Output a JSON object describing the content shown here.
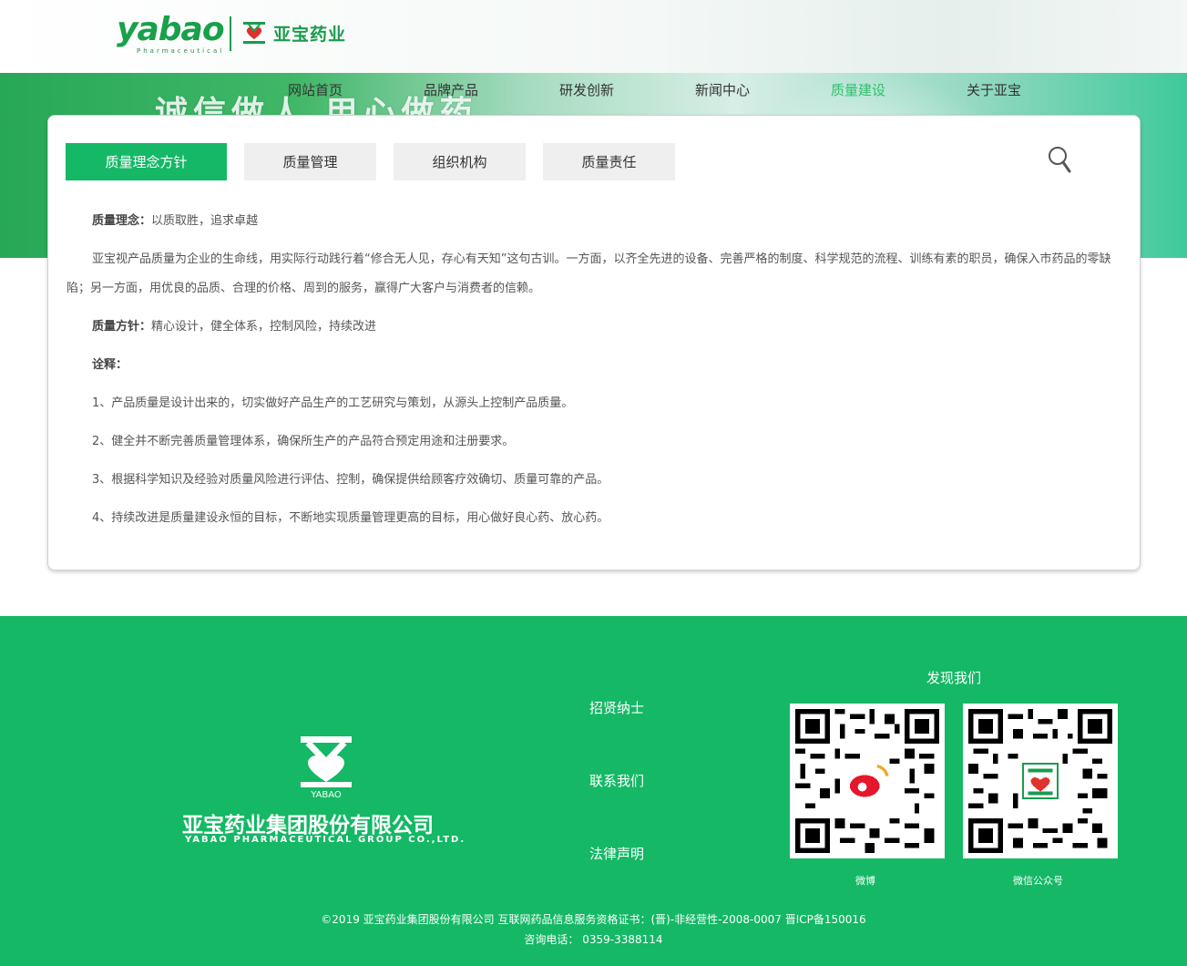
{
  "header": {
    "logo_en": "yabao",
    "logo_en_sub": "Pharmaceutical",
    "logo_cn": "亚宝药业",
    "slogan": "诚信做人 用心做药"
  },
  "nav": {
    "items": [
      {
        "label": "网站首页"
      },
      {
        "label": "品牌产品"
      },
      {
        "label": "研发创新"
      },
      {
        "label": "新闻中心"
      },
      {
        "label": "质量建设",
        "active": true
      },
      {
        "label": "关于亚宝"
      }
    ]
  },
  "tabs": [
    {
      "label": "质量理念方针",
      "active": true
    },
    {
      "label": "质量管理"
    },
    {
      "label": "组织机构"
    },
    {
      "label": "质量责任"
    }
  ],
  "content": {
    "p1_title": "质量理念：",
    "p1_text": "以质取胜，追求卓越",
    "p2_text": "亚宝视产品质量为企业的生命线，用实际行动践行着“修合无人见，存心有天知”这句古训。一方面，以齐全先进的设备、完善严格的制度、科学规范的流程、训练有素的职员，确保入市药品的零缺陷；另一方面，用优良的品质、合理的价格、周到的服务，赢得广大客户与消费者的信赖。",
    "p3_title": "质量方针：",
    "p3_text": "精心设计，健全体系，控制风险，持续改进",
    "p4_title": "诠释：",
    "items": [
      "1、产品质量是设计出来的，切实做好产品生产的工艺研究与策划，从源头上控制产品质量。",
      "2、健全并不断完善质量管理体系，确保所生产的产品符合预定用途和注册要求。",
      "3、根据科学知识及经验对质量风险进行评估、控制，确保提供给顾客疗效确切、质量可靠的产品。",
      "4、持续改进是质量建设永恒的目标，不断地实现质量管理更高的目标，用心做好良心药、放心药。"
    ]
  },
  "footer": {
    "logo_mark_text": "YABAO",
    "company_cn": "亚宝药业集团股份有限公司",
    "company_en": "YABAO PHARMACEUTICAL GROUP CO.,LTD.",
    "links": [
      "招贤纳士",
      "联系我们",
      "法律声明"
    ],
    "find_us": "发现我们",
    "qr_weibo_label": "微博",
    "qr_wechat_label": "微信公众号",
    "copyright": "©2019 亚宝药业集团股份有限公司 互联网药品信息服务资格证书：(晋)-非经营性-2008-0007 晋ICP备150016",
    "hotline": "咨询电话： 0359-3388114"
  },
  "colors": {
    "brand_green": "#14b865",
    "tab_active": "#15b866",
    "nav_active": "#2fbf6b"
  }
}
